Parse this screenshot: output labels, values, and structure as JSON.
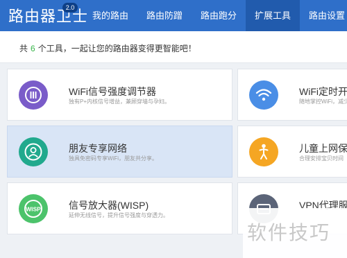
{
  "header": {
    "brand": "路由器卫士",
    "version": "2.0",
    "nav": [
      {
        "label": "我的路由",
        "active": false
      },
      {
        "label": "路由防蹭",
        "active": false
      },
      {
        "label": "路由跑分",
        "active": false
      },
      {
        "label": "扩展工具",
        "active": true
      },
      {
        "label": "路由设置",
        "active": false
      }
    ]
  },
  "summary": {
    "prefix": "共",
    "count": "6",
    "suffix": "个工具，一起让您的路由器变得更智能吧！"
  },
  "tools": [
    {
      "title": "WiFi信号强度调节器",
      "desc": "独有P+内核信号增益，兼顾穿墙与孕妇。",
      "icon": "signal-level-icon",
      "color": "#7a5cc9",
      "highlight": false
    },
    {
      "title": "WiFi定时开关",
      "desc": "随地掌控WiFi，减少",
      "icon": "wifi-icon",
      "color": "#4a8ee6",
      "highlight": false
    },
    {
      "title": "朋友专享网络",
      "desc": "独具免密码专享WiFi，朋友共分享。",
      "icon": "friend-user-icon",
      "color": "#21a98d",
      "highlight": true
    },
    {
      "title": "儿童上网保护",
      "desc": "合理安排宝贝时间",
      "icon": "child-icon",
      "color": "#f5a623",
      "highlight": false
    },
    {
      "title": "信号放大器(WISP)",
      "desc": "延伸无线信号，提升信号强度与穿透力。",
      "icon": "wisp-icon",
      "color": "#4cc36b",
      "highlight": false
    },
    {
      "title": "VPN代理服务",
      "desc": "",
      "icon": "vpn-icon",
      "color": "#5b6478",
      "highlight": false
    }
  ],
  "watermark": "软件技巧"
}
